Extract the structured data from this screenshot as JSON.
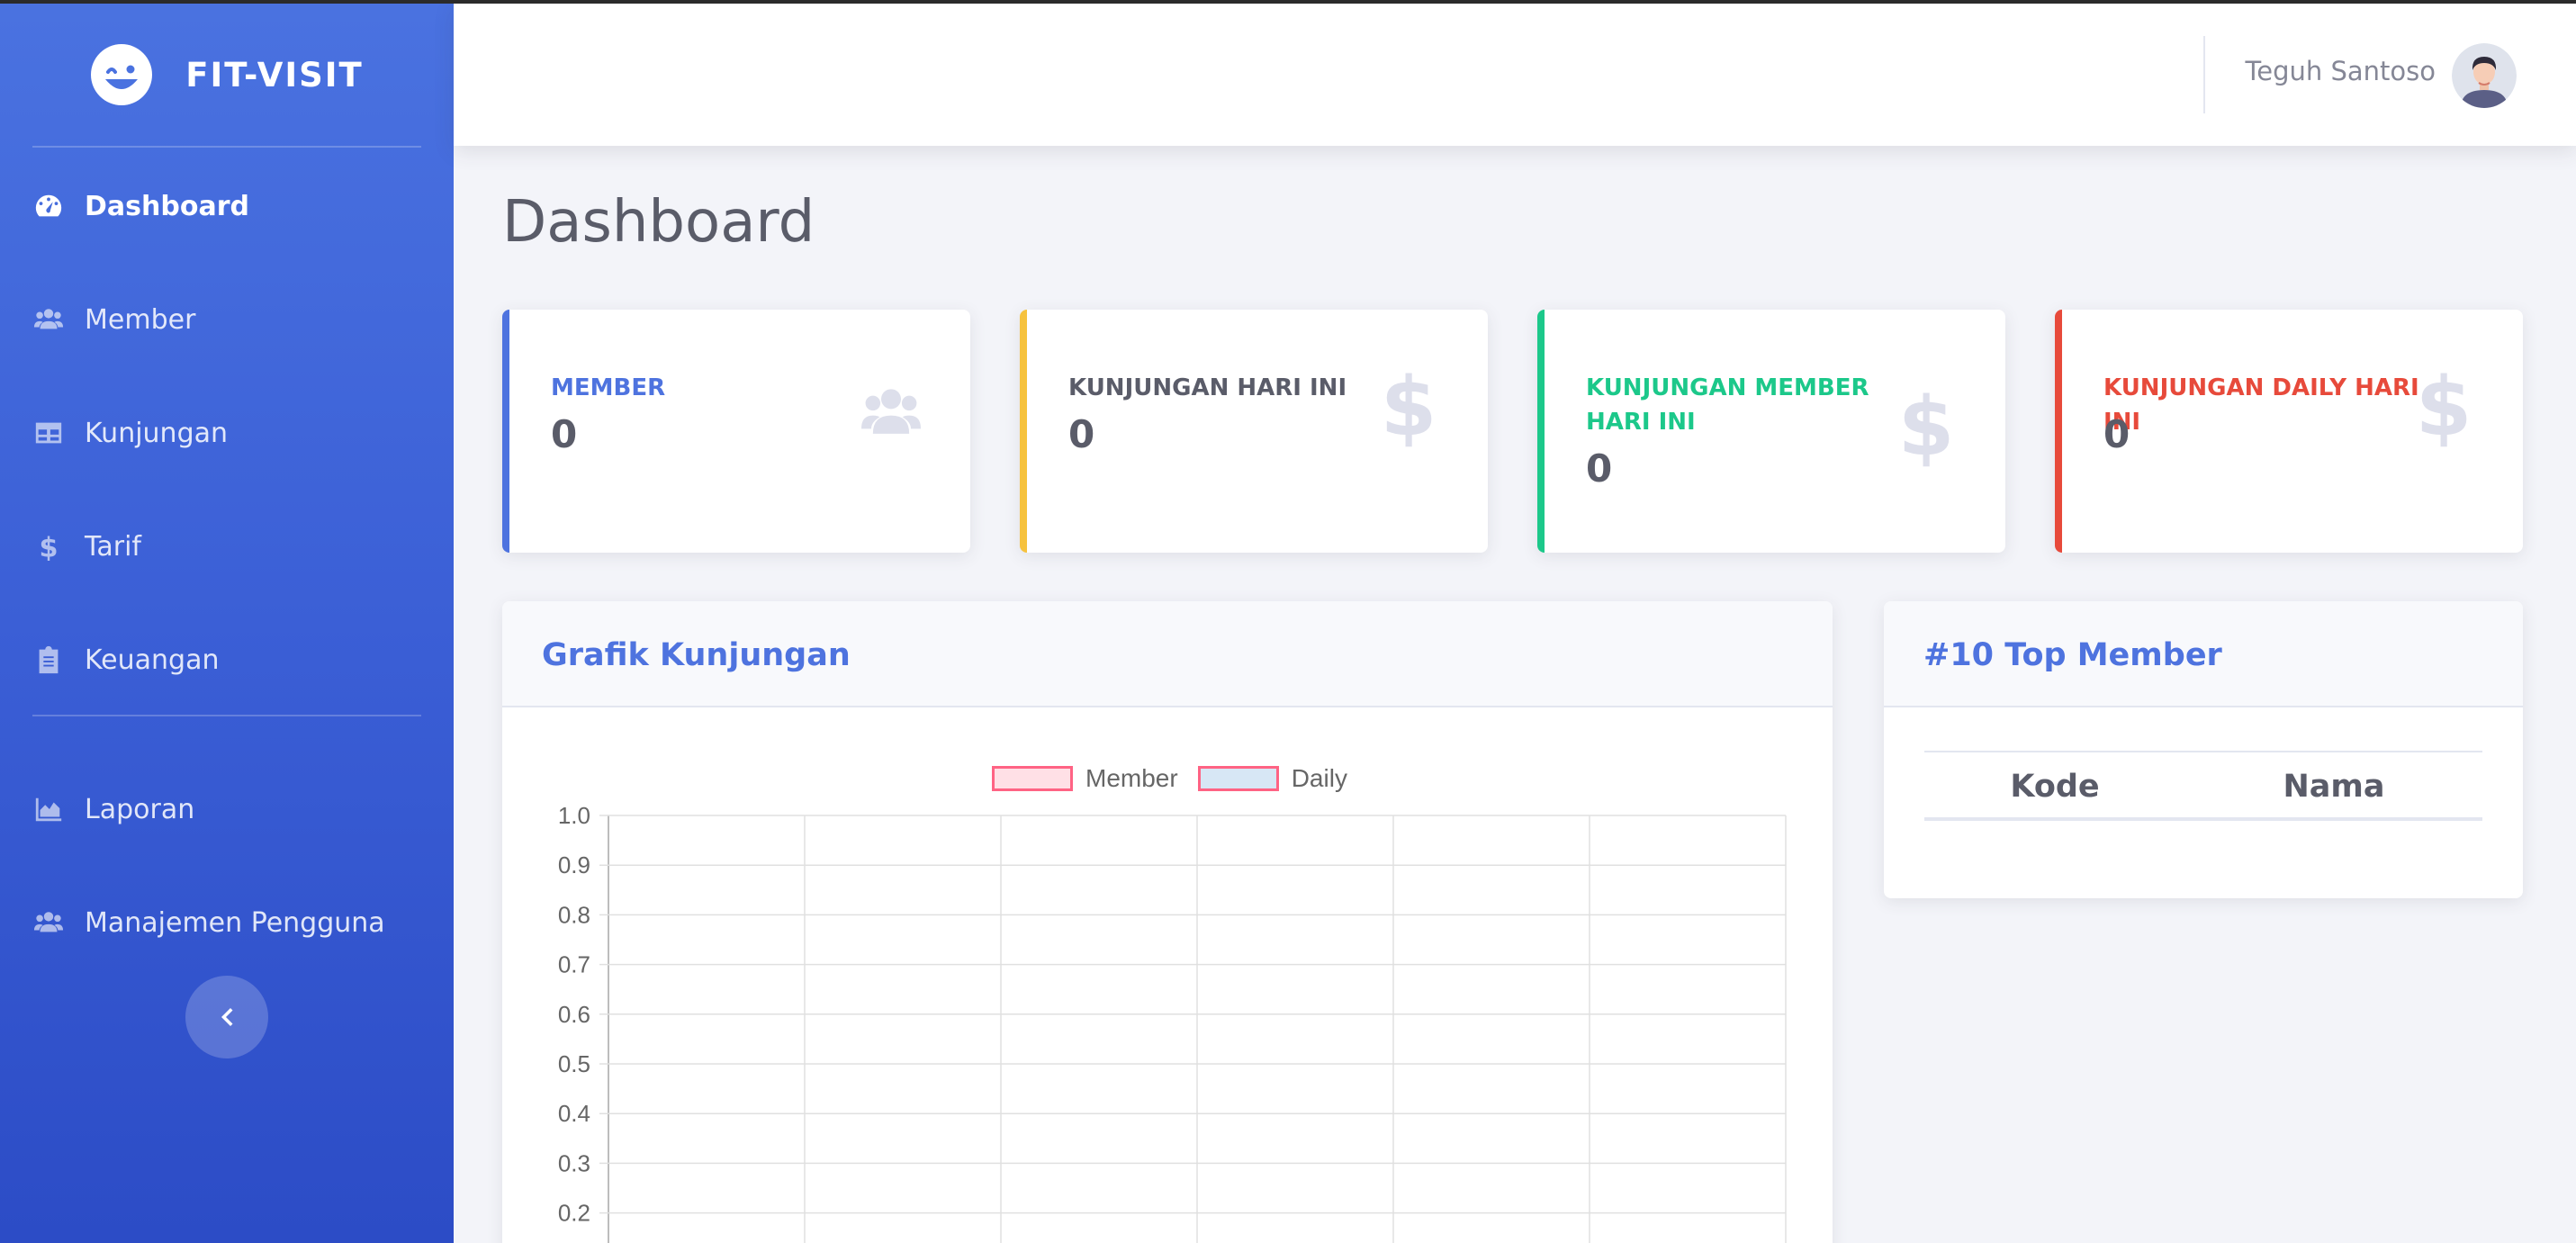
{
  "app": {
    "brand": "FIT-VISIT"
  },
  "sidebar": {
    "items": [
      {
        "label": "Dashboard",
        "icon": "tachometer-icon",
        "active": true
      },
      {
        "label": "Member",
        "icon": "users-icon"
      },
      {
        "label": "Kunjungan",
        "icon": "table-icon"
      },
      {
        "label": "Tarif",
        "icon": "dollar-icon"
      },
      {
        "label": "Keuangan",
        "icon": "clipboard-icon"
      },
      {
        "label": "Laporan",
        "icon": "chart-area-icon"
      },
      {
        "label": "Manajemen Pengguna",
        "icon": "users-icon"
      }
    ],
    "toggle_icon": "chevron-left-icon"
  },
  "topbar": {
    "user_name": "Teguh Santoso"
  },
  "page": {
    "title": "Dashboard"
  },
  "stats": [
    {
      "label": "MEMBER",
      "value": "0",
      "color": "#4e73df",
      "icon": "users-icon"
    },
    {
      "label": "KUNJUNGAN HARI INI",
      "value": "0",
      "color": "#f6c23e",
      "icon": "dollar-icon"
    },
    {
      "label": "KUNJUNGAN MEMBER HARI INI",
      "value": "0",
      "color": "#1cc88a",
      "icon": "dollar-icon"
    },
    {
      "label": "KUNJUNGAN DAILY HARI INI",
      "value": "0",
      "color": "#e74a3b",
      "icon": "dollar-icon"
    }
  ],
  "chart_card": {
    "title": "Grafik Kunjungan"
  },
  "top_member": {
    "title": "#10 Top Member",
    "columns": [
      "Kode",
      "Nama"
    ],
    "rows": []
  },
  "chart_data": {
    "type": "line",
    "title": "",
    "xlabel": "",
    "ylabel": "",
    "ylim": [
      0,
      1.0
    ],
    "y_ticks_visible": [
      "1.0",
      "0.9",
      "0.8",
      "0.7",
      "0.6",
      "0.5",
      "0.4",
      "0.3",
      "0.2"
    ],
    "grid": true,
    "legend_position": "top",
    "series": [
      {
        "name": "Member",
        "values": [],
        "border": "#ff6384",
        "fill": "#ffe0e6"
      },
      {
        "name": "Daily",
        "values": [],
        "border": "#ff6384",
        "fill": "#d7e7f5"
      }
    ]
  }
}
